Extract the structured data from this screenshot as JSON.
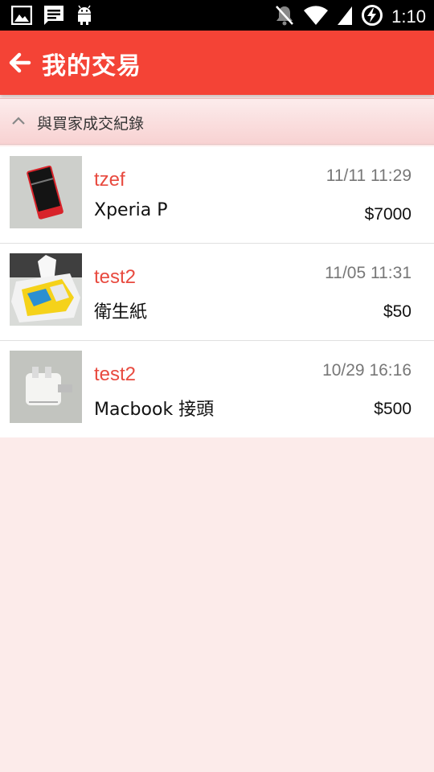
{
  "status_bar": {
    "time": "1:10",
    "left_icons": [
      "image-icon",
      "message-icon",
      "android-icon"
    ],
    "right_icons": [
      "notifications-off-icon",
      "wifi-icon",
      "battery-charging-icon"
    ]
  },
  "app_bar": {
    "title": "我的交易",
    "back_icon": "arrow-back-icon",
    "color": "#f44336"
  },
  "section": {
    "label": "與買家成交紀錄",
    "icon": "chevron-up-icon"
  },
  "transactions": [
    {
      "user": "tzef",
      "product": "Xperia P",
      "date": "11/11 11:29",
      "price": "$7000",
      "thumb": "phone"
    },
    {
      "user": "test2",
      "product": "衛生紙",
      "date": "11/05 11:31",
      "price": "$50",
      "thumb": "tissue"
    },
    {
      "user": "test2",
      "product": "Macbook 接頭",
      "date": "10/29 16:16",
      "price": "$500",
      "thumb": "adapter"
    }
  ],
  "colors": {
    "accent": "#f44336",
    "username": "#e84a3f",
    "background": "#fcebea"
  }
}
